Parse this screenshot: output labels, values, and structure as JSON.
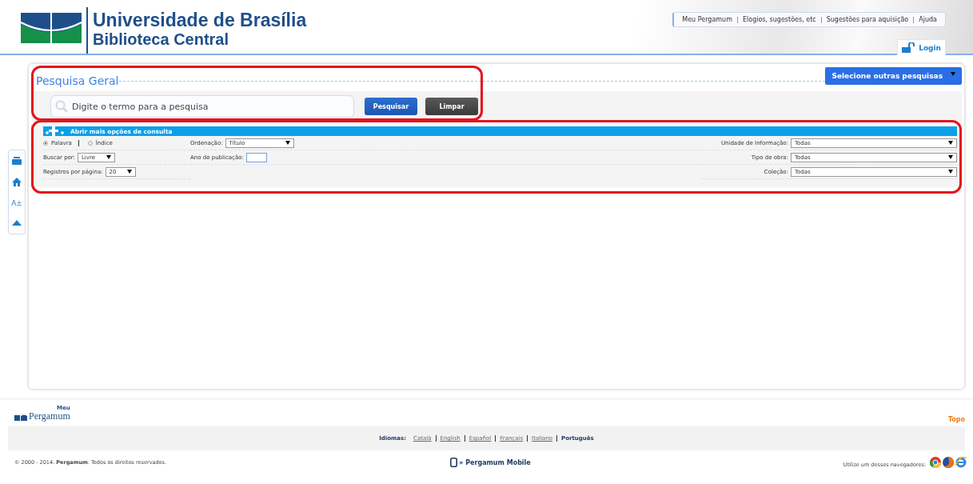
{
  "header": {
    "title": "Universidade de Brasília",
    "subtitle": "Biblioteca Central",
    "top_links": [
      "Meu Pergamum",
      "Elogios, sugestões, etc",
      "Sugestões para aquisição",
      "Ajuda"
    ],
    "login": "Login"
  },
  "side_tools": {
    "font_button": "A±"
  },
  "search": {
    "title": "Pesquisa Geral",
    "other_searches": "Selecione outras pesquisas",
    "placeholder": "Digite o termo para a pesquisa",
    "buttons": [
      {
        "label": "Pesquisar",
        "kind": "primary"
      },
      {
        "label": "Limpar",
        "kind": "secondary"
      }
    ]
  },
  "options": {
    "toggle": "Abrir mais opções de consulta",
    "left": [
      {
        "kind": "radios",
        "options": [
          {
            "label": "Palavra",
            "selected": true
          },
          {
            "label": "Índice",
            "selected": false
          }
        ]
      },
      {
        "kind": "select",
        "label": "Buscar por:",
        "value": "Livre"
      },
      {
        "kind": "select",
        "label": "Registros por página:",
        "value": "20"
      }
    ],
    "middle": [
      {
        "kind": "select",
        "label": "Ordenação:",
        "value": "Título"
      },
      {
        "kind": "input",
        "label": "Ano de publicação:"
      }
    ],
    "right": [
      {
        "kind": "select",
        "label": "Unidade de Informação:",
        "value": "Todas"
      },
      {
        "kind": "select",
        "label": "Tipo de obra:",
        "value": "Todas"
      },
      {
        "kind": "select",
        "label": "Coleção:",
        "value": "Todas"
      }
    ]
  },
  "footer": {
    "logo_top": "Meu",
    "logo_name": "Pergamum",
    "top_link": "Topo",
    "languages_label": "Idiomas:",
    "languages": [
      {
        "label": "Català",
        "selected": false
      },
      {
        "label": "English",
        "selected": false
      },
      {
        "label": "Español",
        "selected": false
      },
      {
        "label": "Français",
        "selected": false
      },
      {
        "label": "Italiano",
        "selected": false
      },
      {
        "label": "Português",
        "selected": true
      }
    ],
    "copyright": "© 2000 - 2014. **Pergamum**. Todos os direitos reservados.",
    "mobile": "» Pergamum Mobile",
    "browsers": "Utilize um desses navegadores:"
  }
}
